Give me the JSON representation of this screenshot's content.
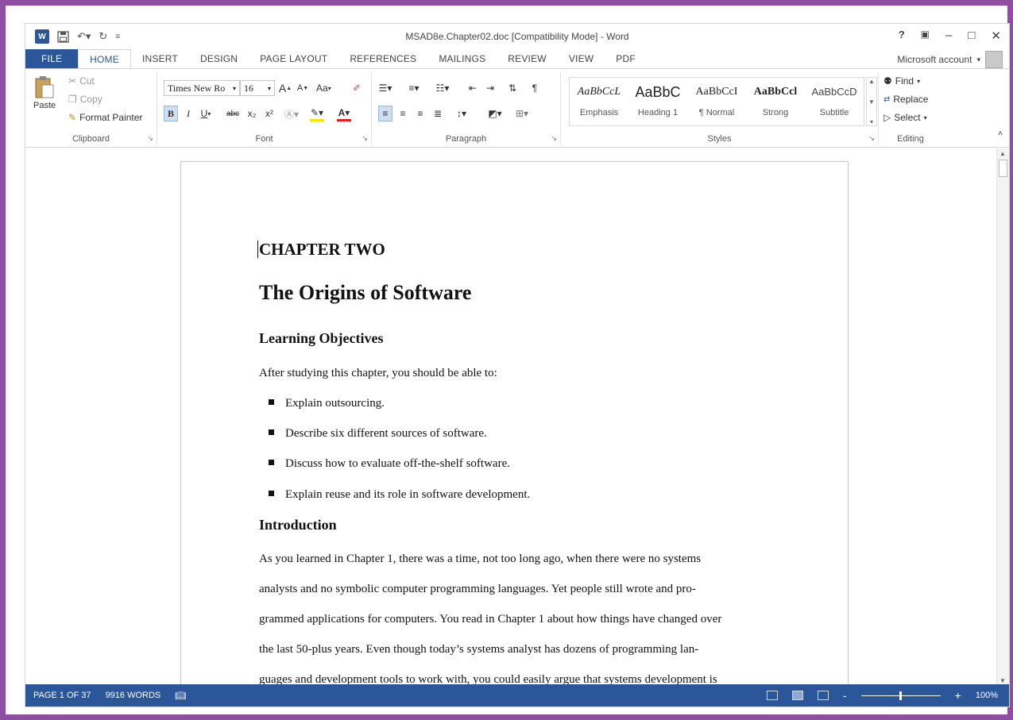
{
  "title_bar": {
    "app_icon": "W",
    "title": "MSAD8e.Chapter02.doc [Compatibility Mode] - Word",
    "help": "?",
    "controls": [
      "–",
      "□",
      "✕"
    ]
  },
  "tabs": [
    {
      "label": "FILE"
    },
    {
      "label": "HOME"
    },
    {
      "label": "INSERT"
    },
    {
      "label": "DESIGN"
    },
    {
      "label": "PAGE LAYOUT"
    },
    {
      "label": "REFERENCES"
    },
    {
      "label": "MAILINGS"
    },
    {
      "label": "REVIEW"
    },
    {
      "label": "VIEW"
    },
    {
      "label": "PDF"
    }
  ],
  "account": "Microsoft account",
  "ribbon": {
    "clipboard": {
      "label": "Clipboard",
      "paste": "Paste",
      "cut": "Cut",
      "copy": "Copy",
      "format_painter": "Format Painter"
    },
    "font": {
      "label": "Font",
      "font_name": "Times New Ro",
      "font_size": "16",
      "change_case": "Aa",
      "bold": "B",
      "italic": "I",
      "underline": "U",
      "strike": "abc",
      "subscript": "x₂",
      "superscript": "x²"
    },
    "paragraph": {
      "label": "Paragraph"
    },
    "styles": {
      "label": "Styles",
      "items": [
        {
          "preview": "AaBbCcL",
          "name": "Emphasis"
        },
        {
          "preview": "AaBbC",
          "name": "Heading 1"
        },
        {
          "preview": "AaBbCcI",
          "name": "¶ Normal"
        },
        {
          "preview": "AaBbCcl",
          "name": "Strong"
        },
        {
          "preview": "AaBbCcD",
          "name": "Subtitle"
        }
      ]
    },
    "editing": {
      "label": "Editing",
      "find": "Find",
      "replace": "Replace",
      "select": "Select"
    }
  },
  "document": {
    "chapter": "CHAPTER TWO",
    "title": "The Origins of Software",
    "objectives_heading": "Learning Objectives",
    "objectives_intro": "After studying this chapter, you should be able to:",
    "bullets": [
      "Explain outsourcing.",
      "Describe six different sources of software.",
      "Discuss how to evaluate off-the-shelf software.",
      "Explain reuse and its role in software development."
    ],
    "intro_heading": "Introduction",
    "intro_lines": [
      "As you learned in Chapter 1, there was a time, not too long ago, when there were no systems",
      "analysts and no symbolic computer programming languages. Yet people still wrote and pro-",
      "grammed applications for computers. You read in Chapter 1 about how things have changed over",
      "the last 50-plus years. Even though today’s systems analyst has dozens of programming lan-"
    ],
    "last_line_squiggle": "guages",
    "last_line_rest": " and development tools to work with, you could easily argue that systems development is"
  },
  "status_bar": {
    "page": "PAGE 1 OF 37",
    "words": "9916 WORDS",
    "zoom_minus": "-",
    "zoom_plus": "+",
    "zoom": "100%"
  }
}
